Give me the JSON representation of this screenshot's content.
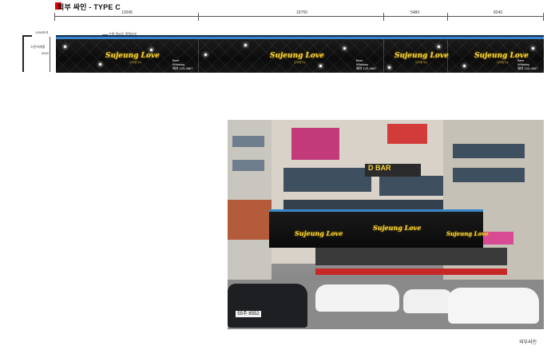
{
  "header": {
    "title": "외부 싸인 - TYPE C"
  },
  "dimensions": {
    "segments": [
      "12045",
      "15750",
      "5480",
      "8240"
    ]
  },
  "side_detail": {
    "thickness": "1350초과",
    "height": "3000",
    "material": "스폰지재질"
  },
  "banner_note": "수렴 알씨무 흑철라미",
  "banner": {
    "logo": "Sujeung Love",
    "logo_sub": "한국명가수",
    "info_line1": "Beer",
    "info_line2": "Whiskey",
    "phone": "예약 123-4567"
  },
  "photo": {
    "car_plate": "55주 8552",
    "shop_sign": "D BAR"
  },
  "caption": "외부싸인"
}
